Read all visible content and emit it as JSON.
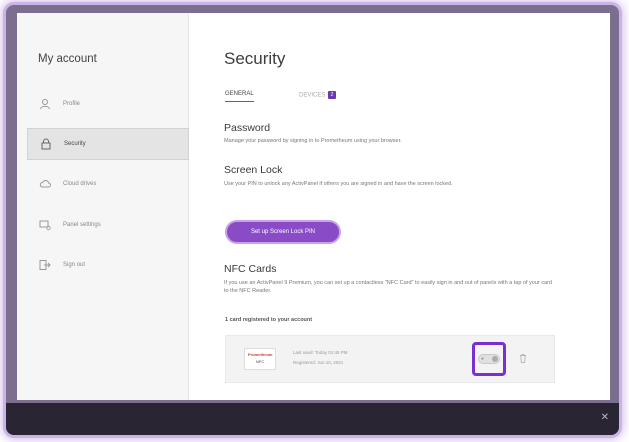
{
  "sidebar": {
    "title": "My account",
    "items": [
      {
        "label": "Profile",
        "icon": "person-icon",
        "active": false
      },
      {
        "label": "Security",
        "icon": "lock-icon",
        "active": true
      },
      {
        "label": "Cloud drives",
        "icon": "cloud-icon",
        "active": false
      },
      {
        "label": "Panel settings",
        "icon": "panel-settings-icon",
        "active": false
      },
      {
        "label": "Sign out",
        "icon": "sign-out-icon",
        "active": false
      }
    ]
  },
  "main": {
    "title": "Security",
    "tabs": [
      {
        "label": "GENERAL",
        "active": true
      },
      {
        "label": "DEVICES",
        "badge": "2",
        "active": false
      }
    ],
    "password": {
      "title": "Password",
      "description": "Manage your password by signing in to Prometheum using your browser."
    },
    "screen_lock": {
      "title": "Screen Lock",
      "description": "Use your PIN to unlock any ActivPanel if others you are signed in and have the screen locked.",
      "button_label": "Set up Screen Lock PIN"
    },
    "nfc": {
      "title": "NFC Cards",
      "description": "If you use an ActivPanel 9 Premium, you can set up a contactless \"NFC Card\" to easily sign in and out of panels with a tap of your card to the NFC Reader.",
      "count_label": "1 card registered to your account",
      "card": {
        "brand": "Prometheum",
        "chip": "NFC",
        "last_used": "Last used: Today 01:45 PM",
        "registered": "Registered: Jun 10, 2021"
      }
    }
  },
  "colors": {
    "accent": "#8a4cc6",
    "highlight": "#7a2fd0",
    "taskbar": "#2a2533"
  }
}
